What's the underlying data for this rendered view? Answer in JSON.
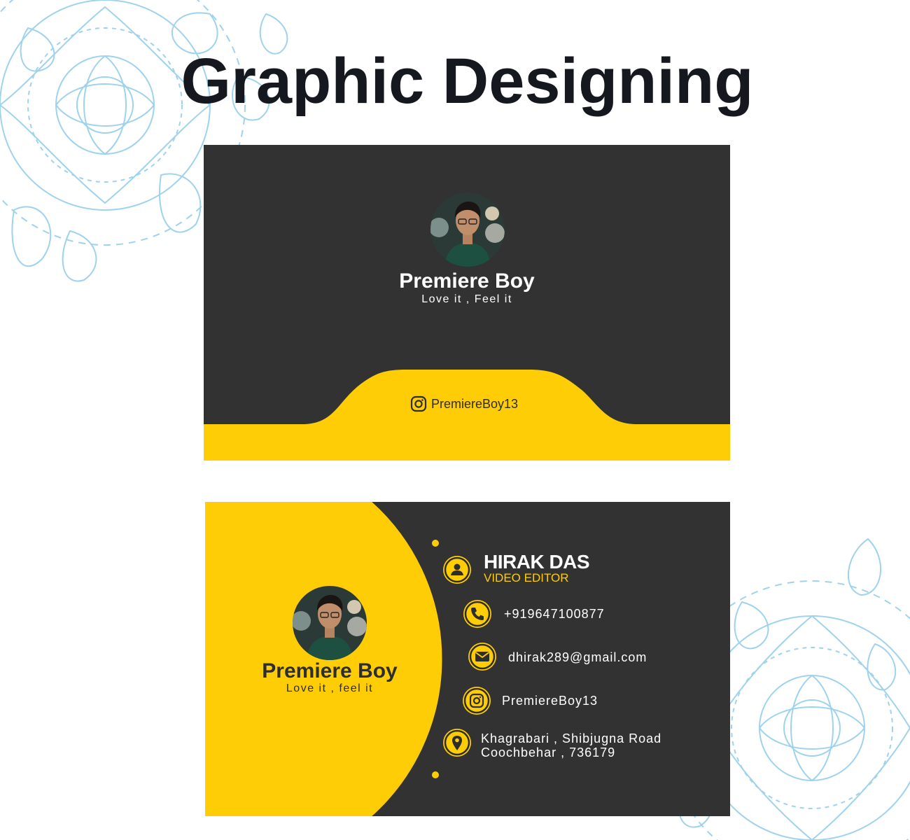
{
  "page": {
    "title": "Graphic Designing"
  },
  "colors": {
    "accent_yellow": "#ffcd05",
    "card_dark": "#323232",
    "title_dark": "#15181f",
    "ornament_blue": "#8fcbea"
  },
  "front_card": {
    "brand": "Premiere Boy",
    "tagline": "Love it , Feel it",
    "instagram_handle": "PremiereBoy13",
    "icons": [
      "avatar-photo",
      "instagram-icon"
    ]
  },
  "back_card": {
    "brand": "Premiere Boy",
    "tagline": "Love it , feel it",
    "name": "HIRAK DAS",
    "role": "VIDEO EDITOR",
    "phone": "+919647100877",
    "email": "dhirak289@gmail.com",
    "instagram_handle": "PremiereBoy13",
    "address_line1": "Khagrabari , Shibjugna Road",
    "address_line2": "Coochbehar , 736179",
    "icons": [
      "user-icon",
      "phone-icon",
      "mail-icon",
      "instagram-icon",
      "location-pin-icon"
    ]
  }
}
